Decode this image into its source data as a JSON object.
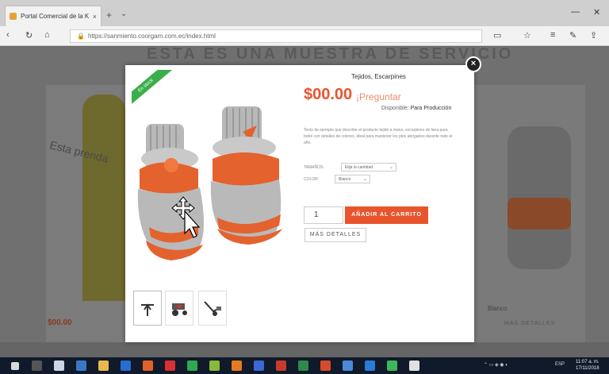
{
  "browser": {
    "tab_title": "Portal Comercial de la K",
    "tab_close": "×",
    "new_tab": "+",
    "tab_menu": "⌄",
    "url": "https://sanmiento.coorgam.com.ec/index.html",
    "window_minimize": "—",
    "window_close": "✕"
  },
  "background": {
    "heading": "ESTA ES UNA MUESTRA DE SERVICIO",
    "left_overlay_text": "Esta prenda",
    "left_price": "$00.00",
    "right_label": "Blanco",
    "right_link": "MÁS DETALLES"
  },
  "modal": {
    "close_label": "×",
    "ribbon": "En stock",
    "title": "Tejidos, Escarpines",
    "price": "$00.00",
    "ask": "¡Preguntar",
    "availability_label": "Disponible:",
    "availability_value": "Para Producción",
    "description": "Texto de ejemplo que describe el producto tejido a mano, escarpines de lana para bebé con detalles de colores, ideal para mantener los pies abrigados durante todo el año.",
    "size_label": "TAMAÑOS:",
    "size_value": "Elija la cantidad",
    "color_label": "COLOR:",
    "color_value": "Blanco",
    "quantity": "1",
    "add_to_cart": "AÑADIR AL CARRITO",
    "more_details": "MÁS DETALLES"
  },
  "taskbar": {
    "tray_text": "ESP",
    "clock_time": "11:07 a. m.",
    "clock_date": "17/11/2018"
  },
  "colors": {
    "accent": "#e8552d",
    "ribbon": "#3aae4a",
    "taskbar": "#101a2a"
  }
}
